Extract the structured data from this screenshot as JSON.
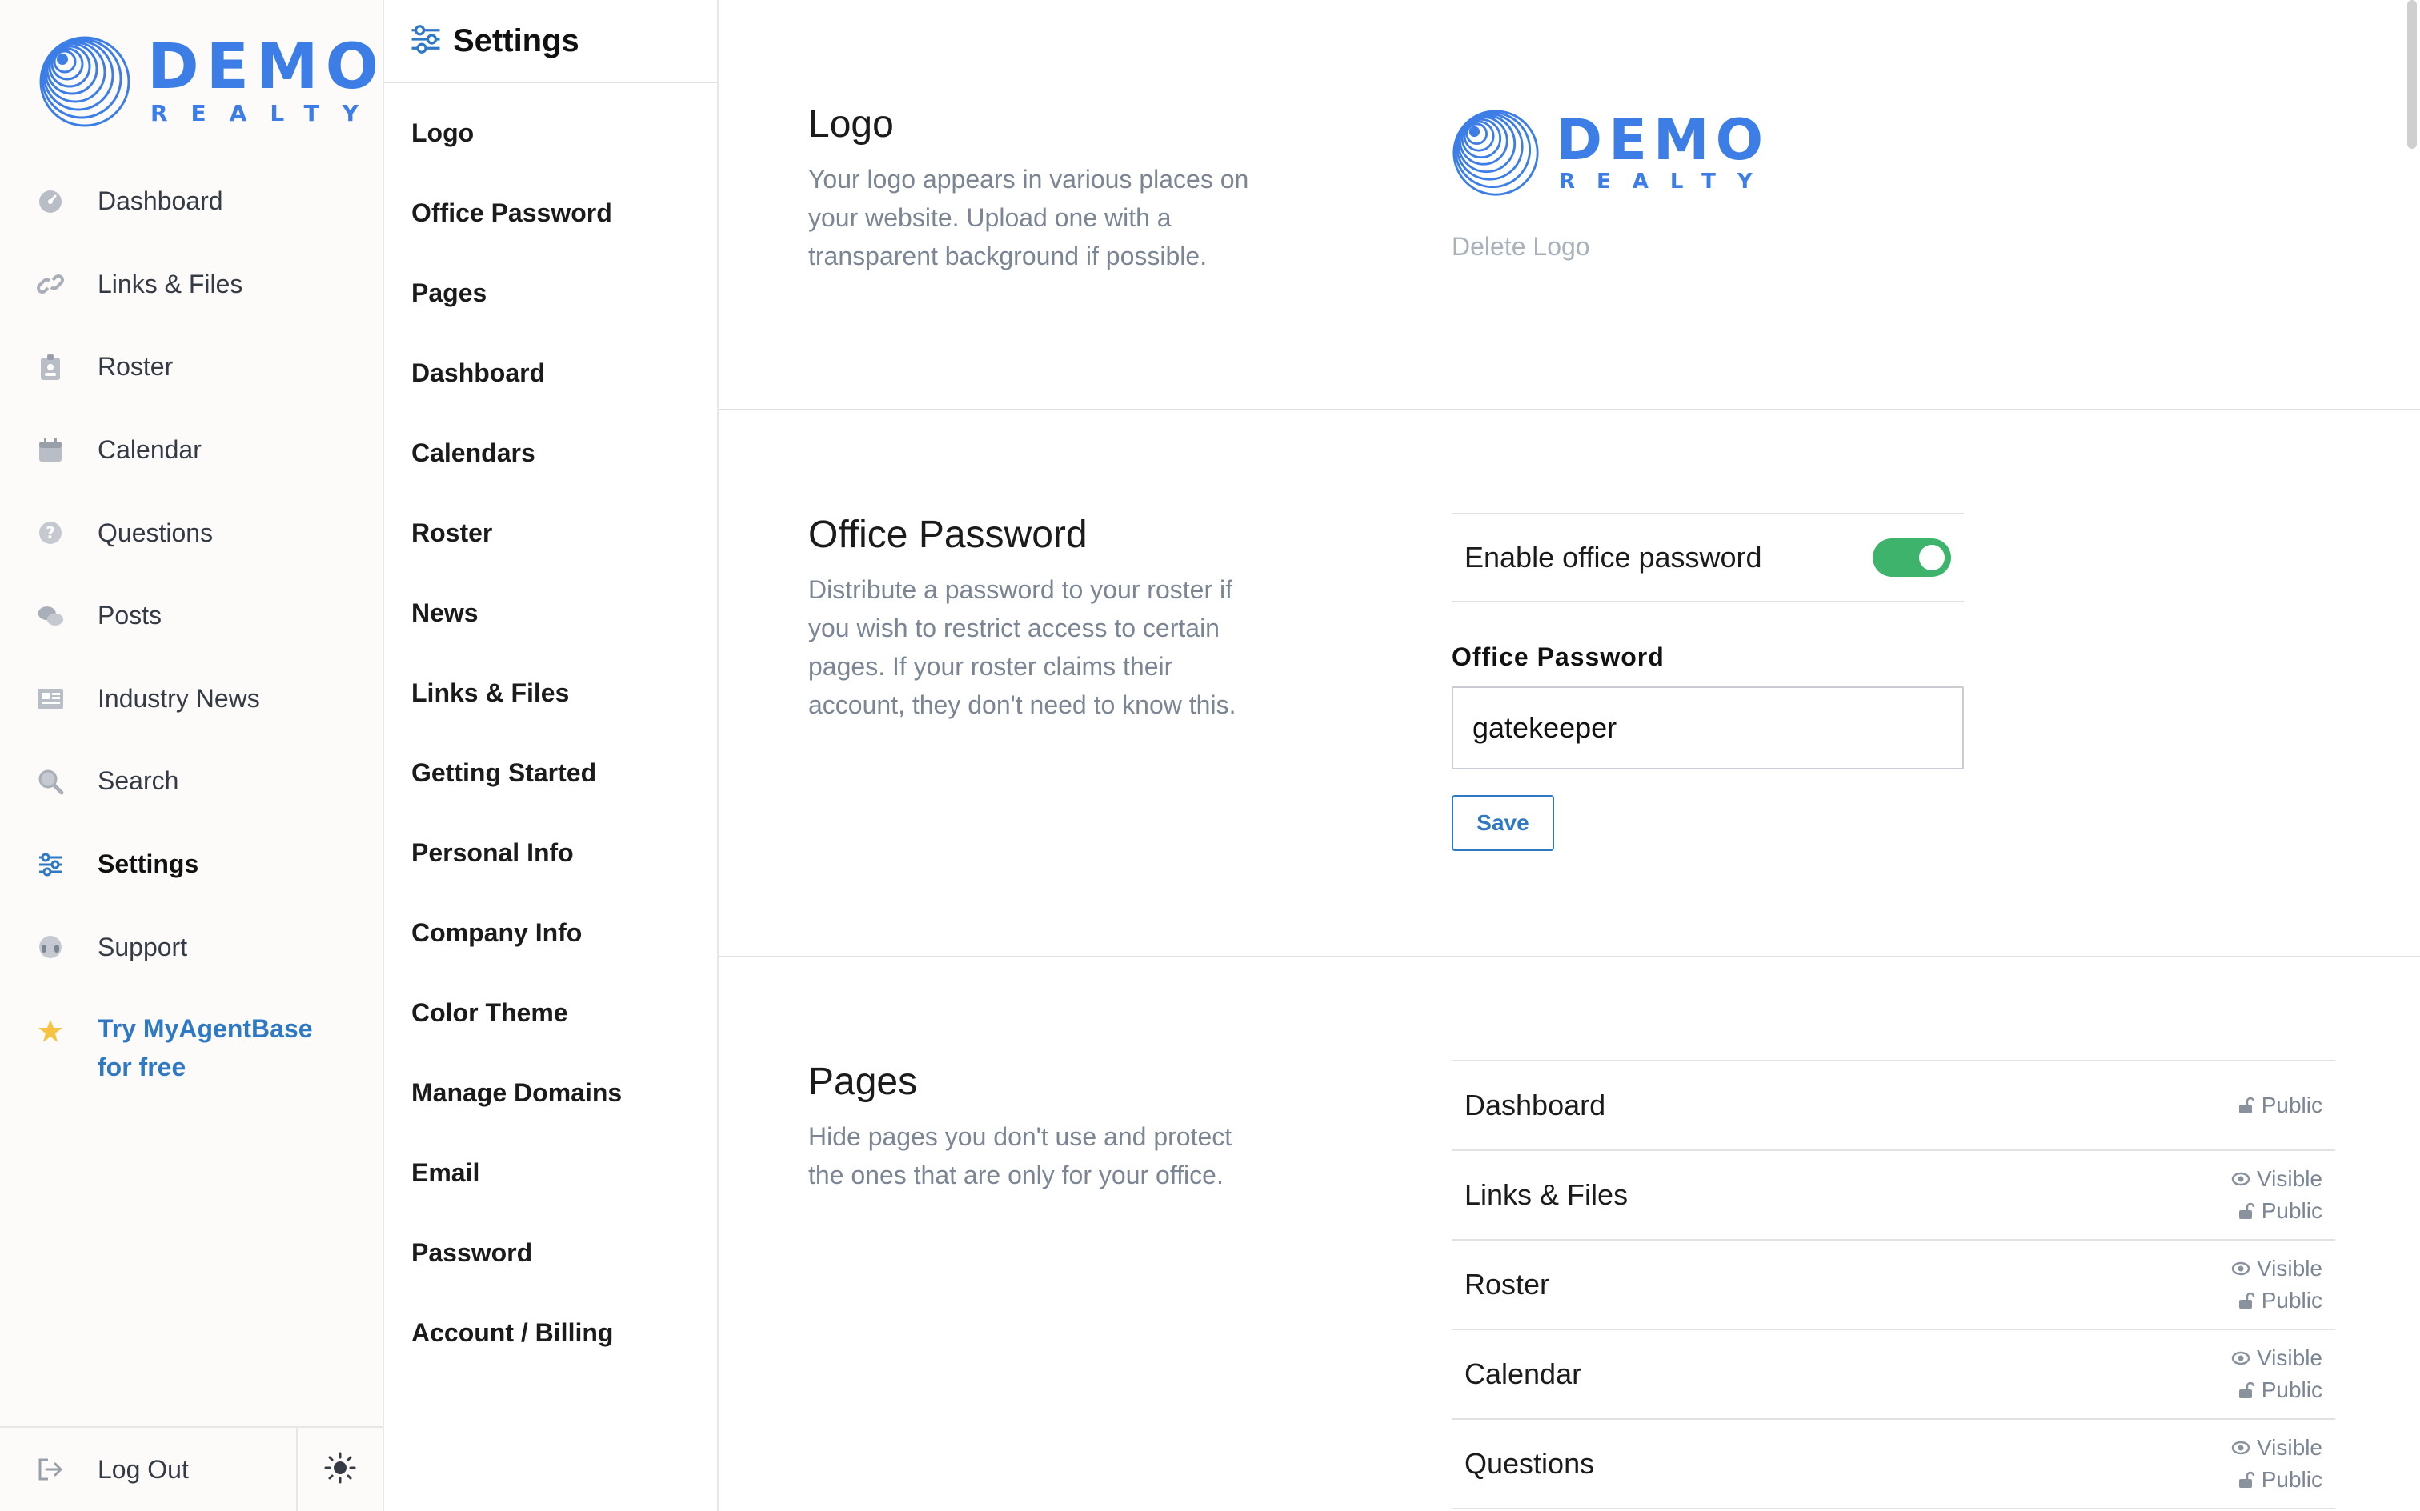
{
  "brand": {
    "name": "DEMO",
    "tagline": "REALTY"
  },
  "nav": {
    "items": [
      {
        "label": "Dashboard",
        "icon": "dashboard-icon"
      },
      {
        "label": "Links & Files",
        "icon": "link-icon"
      },
      {
        "label": "Roster",
        "icon": "badge-icon"
      },
      {
        "label": "Calendar",
        "icon": "calendar-icon"
      },
      {
        "label": "Questions",
        "icon": "question-icon"
      },
      {
        "label": "Posts",
        "icon": "chat-icon"
      },
      {
        "label": "Industry News",
        "icon": "newspaper-icon"
      },
      {
        "label": "Search",
        "icon": "search-icon"
      },
      {
        "label": "Settings",
        "icon": "sliders-icon",
        "active": true
      },
      {
        "label": "Support",
        "icon": "headset-icon"
      }
    ],
    "promo": {
      "label": "Try MyAgentBase for free",
      "icon": "star-icon"
    },
    "logout": {
      "label": "Log Out",
      "icon": "logout-icon"
    },
    "theme_icon": "sun-icon"
  },
  "submenu": {
    "title": "Settings",
    "items": [
      "Logo",
      "Office Password",
      "Pages",
      "Dashboard",
      "Calendars",
      "Roster",
      "News",
      "Links & Files",
      "Getting Started",
      "Personal Info",
      "Company Info",
      "Color Theme",
      "Manage Domains",
      "Email",
      "Password",
      "Account / Billing"
    ]
  },
  "logo_section": {
    "title": "Logo",
    "description": "Your logo appears in various places on your website. Upload one with a transparent background if possible.",
    "delete_label": "Delete Logo"
  },
  "password_section": {
    "title": "Office Password",
    "description": "Distribute a password to your roster if you wish to restrict access to certain pages. If your roster claims their account, they don't need to know this.",
    "toggle_label": "Enable office password",
    "toggle_on": true,
    "field_label": "Office Password",
    "value": "gatekeeper",
    "save_label": "Save"
  },
  "pages_section": {
    "title": "Pages",
    "description": "Hide pages you don't use and protect the ones that are only for your office.",
    "pages": [
      {
        "name": "Dashboard",
        "visibility": null,
        "access": "Public"
      },
      {
        "name": "Links & Files",
        "visibility": "Visible",
        "access": "Public"
      },
      {
        "name": "Roster",
        "visibility": "Visible",
        "access": "Public"
      },
      {
        "name": "Calendar",
        "visibility": "Visible",
        "access": "Public"
      },
      {
        "name": "Questions",
        "visibility": "Visible",
        "access": "Public"
      }
    ]
  },
  "colors": {
    "accent": "#2f78c4",
    "brand": "#3d7ee6",
    "toggle": "#3db36b",
    "muted": "#7b8594"
  }
}
